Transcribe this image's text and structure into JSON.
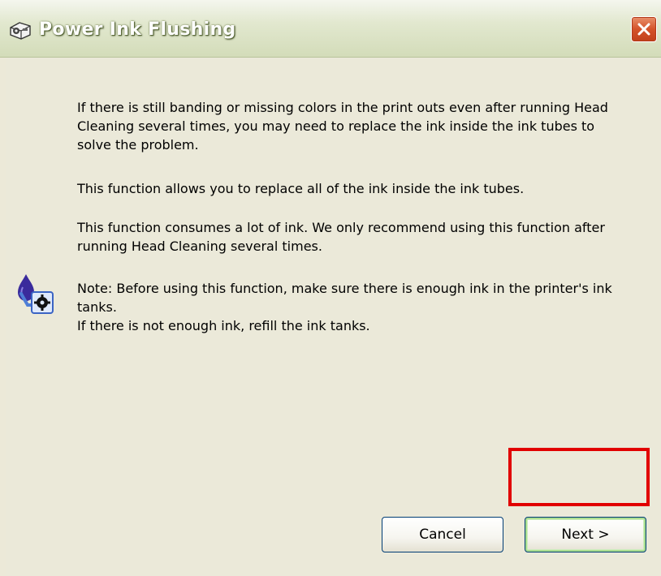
{
  "window": {
    "title": "Power Ink Flushing",
    "title_icon": "printer-gear-icon",
    "close_icon": "close-icon"
  },
  "content": {
    "paragraph_1": "If there is still banding or missing colors in the print outs even after running Head Cleaning several times, you may need to replace the ink inside the ink tubes to solve the problem.",
    "paragraph_2": "This function allows you to replace all of the ink inside the ink tubes.",
    "paragraph_3": "This function consumes a lot of ink. We only recommend using this function after running Head Cleaning several times.",
    "note_line_1": "Note: Before using this function, make sure there is enough ink in the printer's ink tanks.",
    "note_line_2": "If there is not enough ink, refill the ink tanks.",
    "note_icon": "ink-bottle-gear-icon"
  },
  "buttons": {
    "cancel_label": "Cancel",
    "next_label": "Next >"
  },
  "colors": {
    "highlight": "#e10000",
    "titlebar": "#d3dcb9",
    "close_button": "#d4532a",
    "dialog_background": "#ebe9d9"
  }
}
